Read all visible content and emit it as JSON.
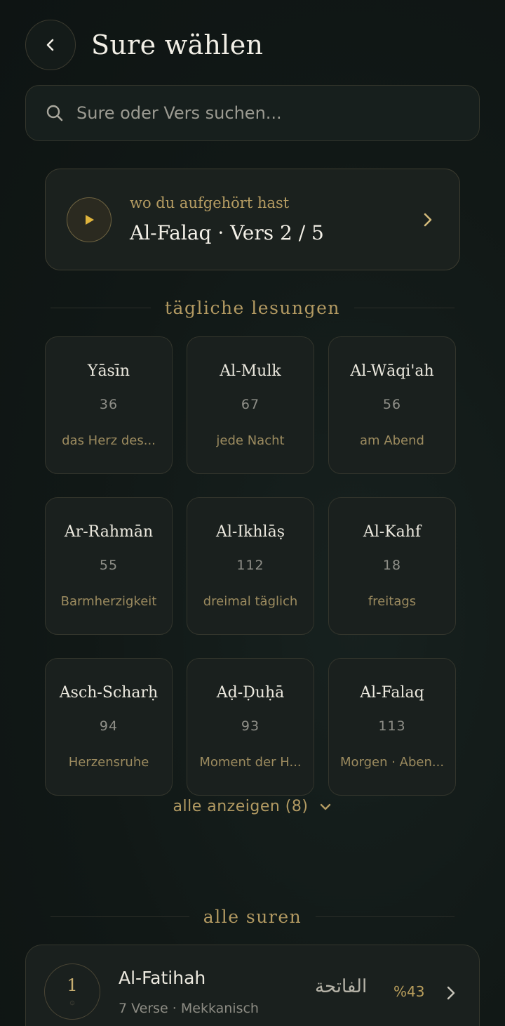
{
  "header": {
    "title": "Sure wählen"
  },
  "search": {
    "placeholder": "Sure oder Vers suchen..."
  },
  "resume": {
    "label": "wo du aufgehört hast",
    "title": "Al-Falaq · Vers 2 / 5"
  },
  "daily": {
    "heading": "tägliche lesungen",
    "items": [
      {
        "name": "Yāsīn",
        "number": "36",
        "note": "das Herz des..."
      },
      {
        "name": "Al-Mulk",
        "number": "67",
        "note": "jede Nacht"
      },
      {
        "name": "Al-Wāqi'ah",
        "number": "56",
        "note": "am Abend"
      },
      {
        "name": "Ar-Rahmān",
        "number": "55",
        "note": "Barmherzigkeit"
      },
      {
        "name": "Al-Ikhlāṣ",
        "number": "112",
        "note": "dreimal täglich"
      },
      {
        "name": "Al-Kahf",
        "number": "18",
        "note": "freitags"
      },
      {
        "name": "Asch-Scharḥ",
        "number": "94",
        "note": "Herzensruhe"
      },
      {
        "name": "Aḍ-Ḍuḥā",
        "number": "93",
        "note": "Moment der H..."
      },
      {
        "name": "Al-Falaq",
        "number": "113",
        "note": "Morgen · Aben..."
      }
    ],
    "show_all": "alle anzeigen (8)"
  },
  "all_surahs": {
    "heading": "alle suren",
    "items": [
      {
        "number": "1",
        "name": "Al-Fatihah",
        "meta": "7 Verse · Mekkanisch",
        "arabic": "الفاتحة",
        "progress": "%43"
      }
    ]
  },
  "colors": {
    "accent": "#b59c62",
    "background": "#111816"
  }
}
